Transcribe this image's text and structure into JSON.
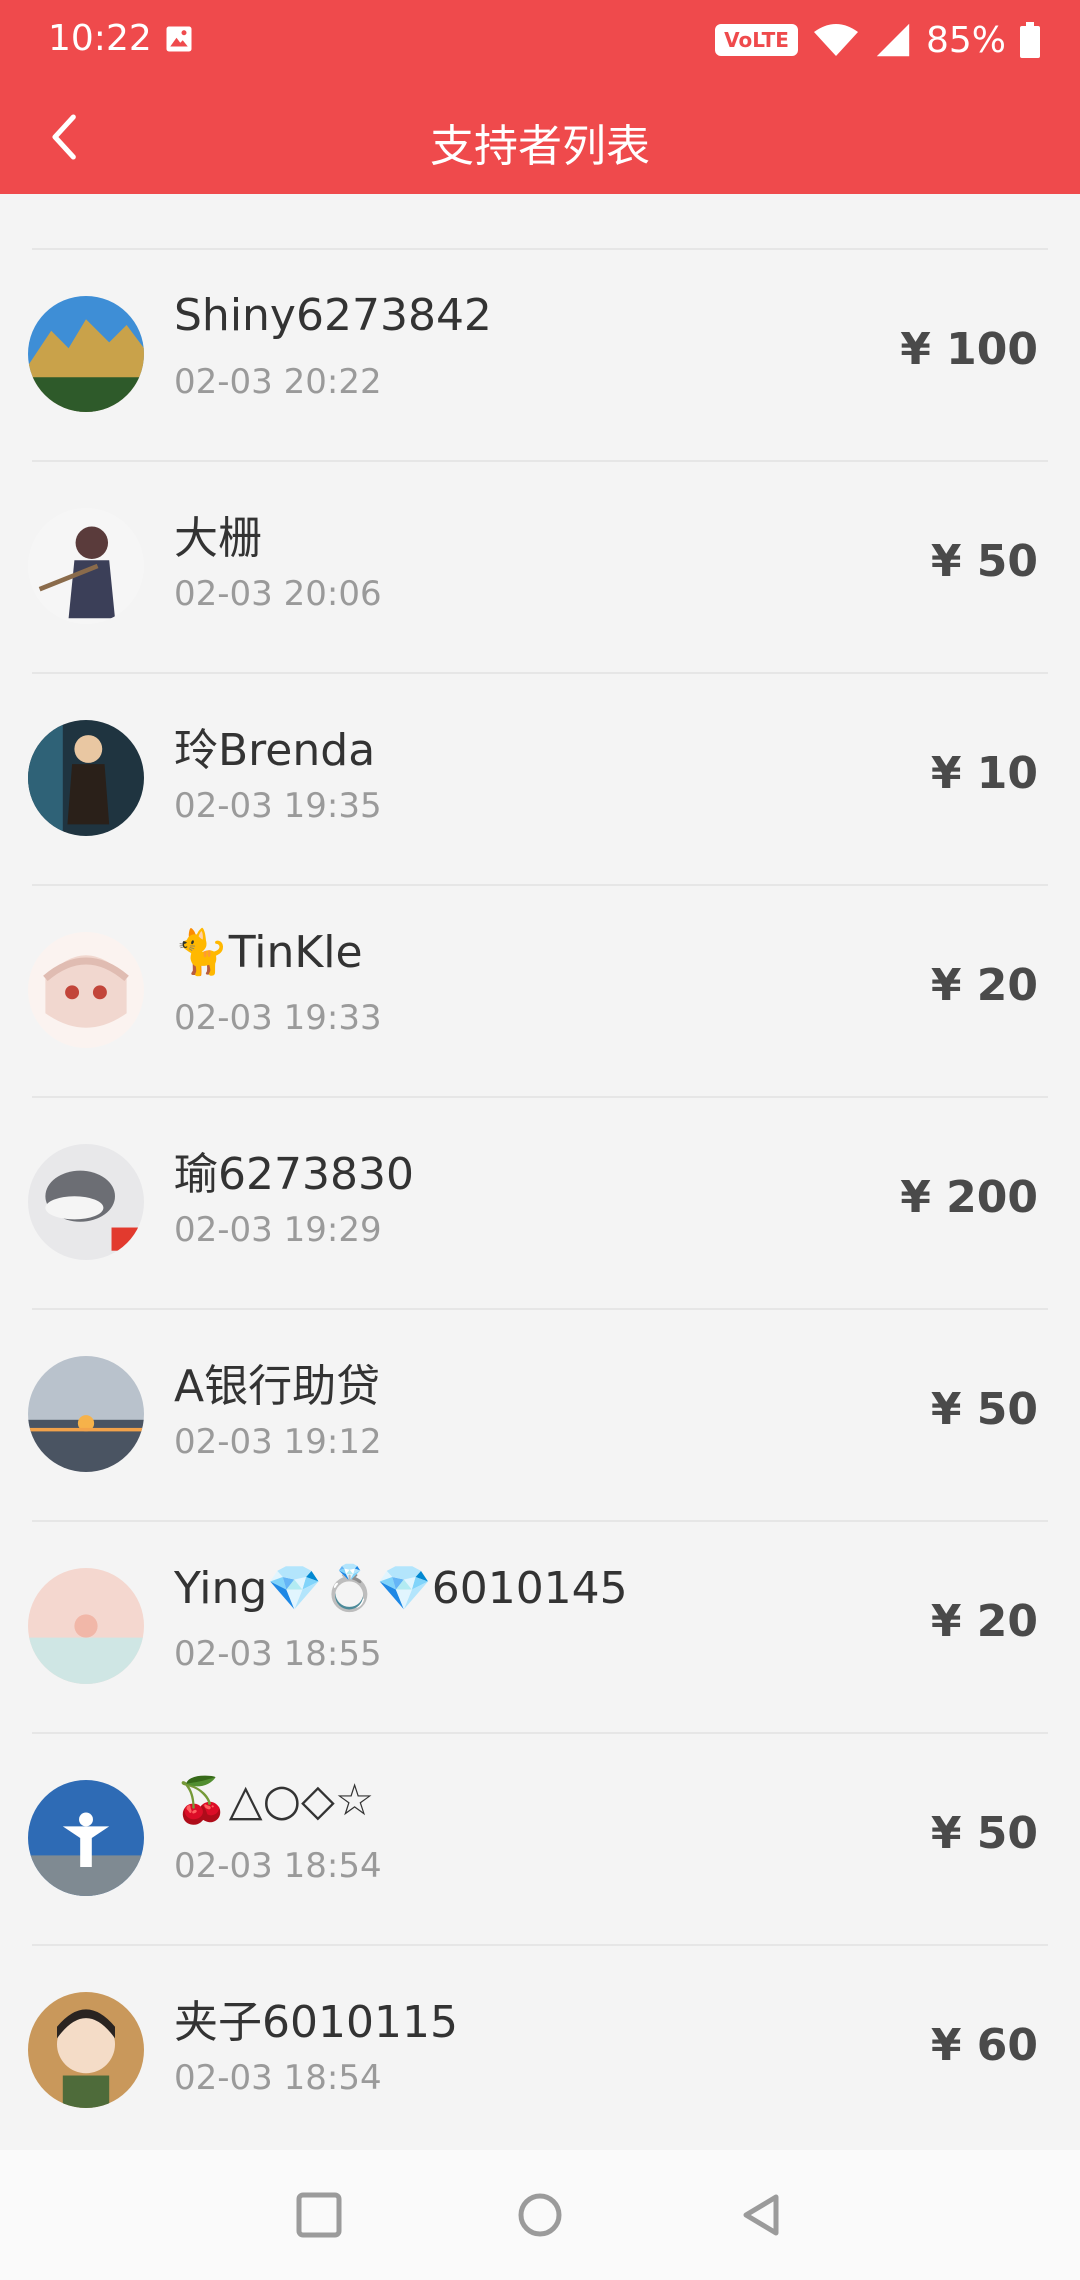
{
  "status_bar": {
    "time": "10:22",
    "battery_percent": "85%",
    "volte_label": "VoLTE",
    "icons": [
      "gallery-icon",
      "volte-icon",
      "wifi-icon",
      "signal-icon",
      "battery-icon"
    ]
  },
  "app_bar": {
    "title": "支持者列表",
    "back_icon": "back-arrow-icon"
  },
  "colors": {
    "accent": "#ef4a4c",
    "background": "#f4f4f4",
    "divider": "#e6e6e6",
    "name_text": "#333333",
    "time_text": "#9a9a9a",
    "amount_text": "#4a4a4a"
  },
  "supporters": [
    {
      "name": "Shiny6273842",
      "time": "02-03 20:22",
      "amount": "¥ 100"
    },
    {
      "name": "大栅",
      "time": "02-03 20:06",
      "amount": "¥ 50"
    },
    {
      "name": "玲Brenda",
      "time": "02-03 19:35",
      "amount": "¥ 10"
    },
    {
      "name": "🐈TinKle",
      "time": "02-03 19:33",
      "amount": "¥ 20"
    },
    {
      "name": "瑜6273830",
      "time": "02-03 19:29",
      "amount": "¥ 200"
    },
    {
      "name": "A银行助贷",
      "time": "02-03 19:12",
      "amount": "¥ 50"
    },
    {
      "name": "Ying💎💍💎6010145",
      "time": "02-03 18:55",
      "amount": "¥ 20"
    },
    {
      "name": "🍒△○◇☆",
      "time": "02-03 18:54",
      "amount": "¥ 50"
    },
    {
      "name": "夹子6010115",
      "time": "02-03 18:54",
      "amount": "¥ 60"
    }
  ],
  "nav_bar": {
    "icons": [
      "recents-square-icon",
      "home-circle-icon",
      "back-triangle-icon"
    ]
  }
}
